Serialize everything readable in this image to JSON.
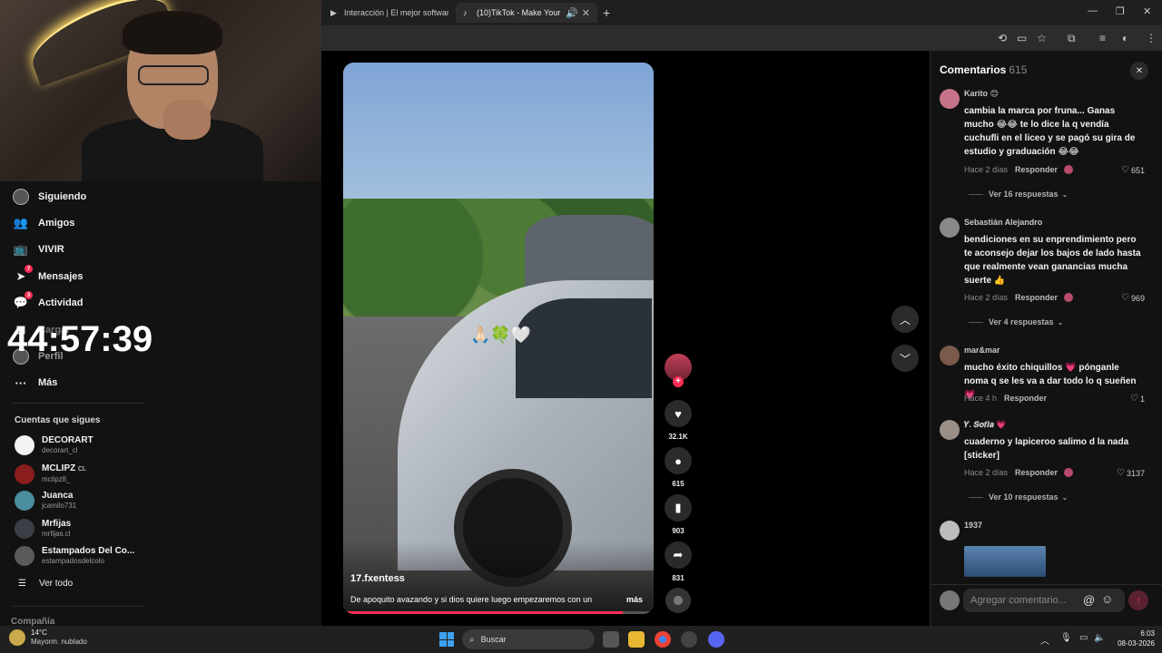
{
  "browser": {
    "tabs": [
      {
        "label": "Interacción | El mejor software g"
      },
      {
        "label": "(10)TikTok - Make Your Day"
      }
    ],
    "new_tab": "+",
    "minimize": "—",
    "restore": "❐",
    "close": "✕"
  },
  "timer": "44:57:39",
  "sidebar": {
    "items": [
      {
        "label": "Siguiendo"
      },
      {
        "label": "Amigos"
      },
      {
        "label": "VIVIR"
      },
      {
        "label": "Mensajes",
        "badge": "7"
      },
      {
        "label": "Actividad",
        "badge": "3"
      },
      {
        "label": "Cargar"
      },
      {
        "label": "Perfil"
      },
      {
        "label": "Más"
      }
    ],
    "following_label": "Cuentas que sigues",
    "accounts": [
      {
        "name": "DECORART",
        "user": "decorart_cl"
      },
      {
        "name": "MCLIPZ",
        "suffix": "CL",
        "user": "mclipz8_"
      },
      {
        "name": "Juanca",
        "user": "jcamilo731"
      },
      {
        "name": "Mrfijas",
        "user": "mrfijas.cl"
      },
      {
        "name": "Estampados Del Co...",
        "user": "estampadosdelcolo"
      }
    ],
    "see_all": "Ver todo",
    "company": "Compañía"
  },
  "video": {
    "author": "17.fxentess",
    "caption": "De apoquito avazando y si dios quiere luego empezaremos con un",
    "more": "más",
    "overlay_emoji": "🙏🏻🍀🤍",
    "progress": 0.9
  },
  "actions": {
    "likes": "32.1K",
    "comments": "615",
    "saves": "903",
    "shares": "831"
  },
  "comments": {
    "title": "Comentarios",
    "count": "615",
    "reply_label": "Responder",
    "items": [
      {
        "name": "Karito 😊",
        "text": "cambia la marca por fruna... Ganas mucho 😂😂 te lo dice la q vendía cuchufli en el liceo y se pagó su gira de estudio y graduación 😂😂",
        "time": "Hace 2 días",
        "likes": "651",
        "view_replies": "Ver 16 respuestas"
      },
      {
        "name": "Sebastián Alejandro",
        "text": "bendiciones en su enprendimiento pero te aconsejo dejar los bajos de lado hasta que realmente vean ganancias mucha suerte 👍",
        "time": "Hace 2 días",
        "likes": "969",
        "view_replies": "Ver 4 respuestas"
      },
      {
        "name": "mar&mar",
        "text": "mucho éxito chiquillos 💗 pónganle noma q se les va a dar todo lo q sueñen 💗",
        "time": "Hace 4 h",
        "likes": "1"
      },
      {
        "name": "𝒀. 𝑺𝒐𝒇𝒊𝒂 💗",
        "text": "cuaderno y lapiceroo salimo d la nada [sticker]",
        "time": "Hace 2 días",
        "likes": "3137",
        "view_replies": "Ver 10 respuestas"
      },
      {
        "name": "1937"
      }
    ],
    "input_placeholder": "Agregar comentario..."
  },
  "taskbar": {
    "temp": "14°C",
    "weather": "Mayorm. nublado",
    "search": "Buscar",
    "time": "6:03",
    "date": "08-03-2026"
  },
  "colors": {
    "accent": "#fe2c55",
    "background": "#121212"
  }
}
